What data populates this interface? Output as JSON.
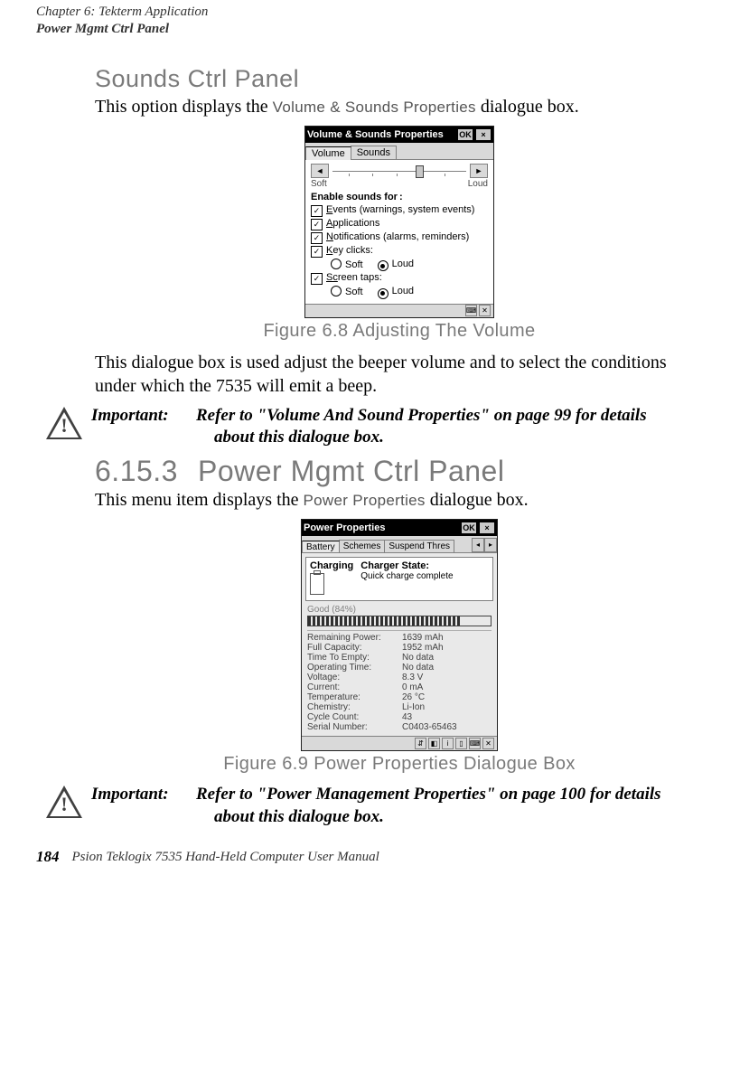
{
  "header": {
    "chapter": "Chapter 6: Tekterm Application",
    "section": "Power Mgmt Ctrl Panel"
  },
  "sounds": {
    "heading": "Sounds Ctrl Panel",
    "intro_pre": "This option displays the ",
    "intro_term": "Volume & Sounds Properties",
    "intro_post": " dialogue box.",
    "window_title": "Volume & Sounds Properties",
    "ok": "OK",
    "close": "×",
    "tab_volume": "Volume",
    "tab_sounds": "Sounds",
    "left_arrow": "◄",
    "right_arrow": "►",
    "soft": "Soft",
    "loud": "Loud",
    "enable_label": "Enable sounds for",
    "cb_events_pre": "E",
    "cb_events_post": "vents (warnings, system events)",
    "cb_apps_pre": "A",
    "cb_apps_post": "pplications",
    "cb_notif_pre": "N",
    "cb_notif_post": "otifications (alarms, reminders)",
    "cb_key_pre": "K",
    "cb_key_post": "ey clicks:",
    "radio_soft": "Soft",
    "radio_loud": "Loud",
    "cb_screen_pre": "Sc",
    "cb_screen_post": "reen taps:",
    "caption": "Figure 6.8 Adjusting The Volume",
    "note": "This dialogue box is used adjust the beeper volume and to select the conditions under which the 7535 will emit a beep.",
    "imp_label": "Important:",
    "imp_text1": "Refer to \"Volume And Sound Properties\" on page 99 for details",
    "imp_text2": "about this dialogue box."
  },
  "power": {
    "num": "6.15.3",
    "title": "Power Mgmt Ctrl Panel",
    "intro_pre": "This menu item displays the ",
    "intro_term": "Power Properties",
    "intro_post": " dialogue box.",
    "window_title": "Power Properties",
    "ok": "OK",
    "close": "×",
    "tab_battery": "Battery",
    "tab_schemes": "Schemes",
    "tab_suspend": "Suspend Thres",
    "left_sc": "◂",
    "right_sc": "▸",
    "status_charging": "Charging",
    "status_charger_state": "Charger State:",
    "status_text": "Quick charge complete",
    "good": "Good  (84%)",
    "rows": [
      {
        "l": "Remaining Power:",
        "v": "1639 mAh"
      },
      {
        "l": "Full Capacity:",
        "v": "1952 mAh"
      },
      {
        "l": "Time To Empty:",
        "v": "No data"
      },
      {
        "l": "Operating Time:",
        "v": "No data"
      },
      {
        "l": "Voltage:",
        "v": "8.3 V"
      },
      {
        "l": "Current:",
        "v": "0 mA"
      },
      {
        "l": "Temperature:",
        "v": "26 °C"
      },
      {
        "l": "Chemistry:",
        "v": "Li-Ion"
      },
      {
        "l": "Cycle Count:",
        "v": "43"
      },
      {
        "l": "Serial Number:",
        "v": "C0403-65463"
      }
    ],
    "caption": "Figure 6.9 Power Properties Dialogue Box",
    "imp_label": "Important:",
    "imp_text1": "Refer to \"Power Management Properties\" on page 100 for details",
    "imp_text2": "about this dialogue box."
  },
  "footer": {
    "page": "184",
    "title": "Psion Teklogix 7535 Hand-Held Computer User Manual"
  }
}
